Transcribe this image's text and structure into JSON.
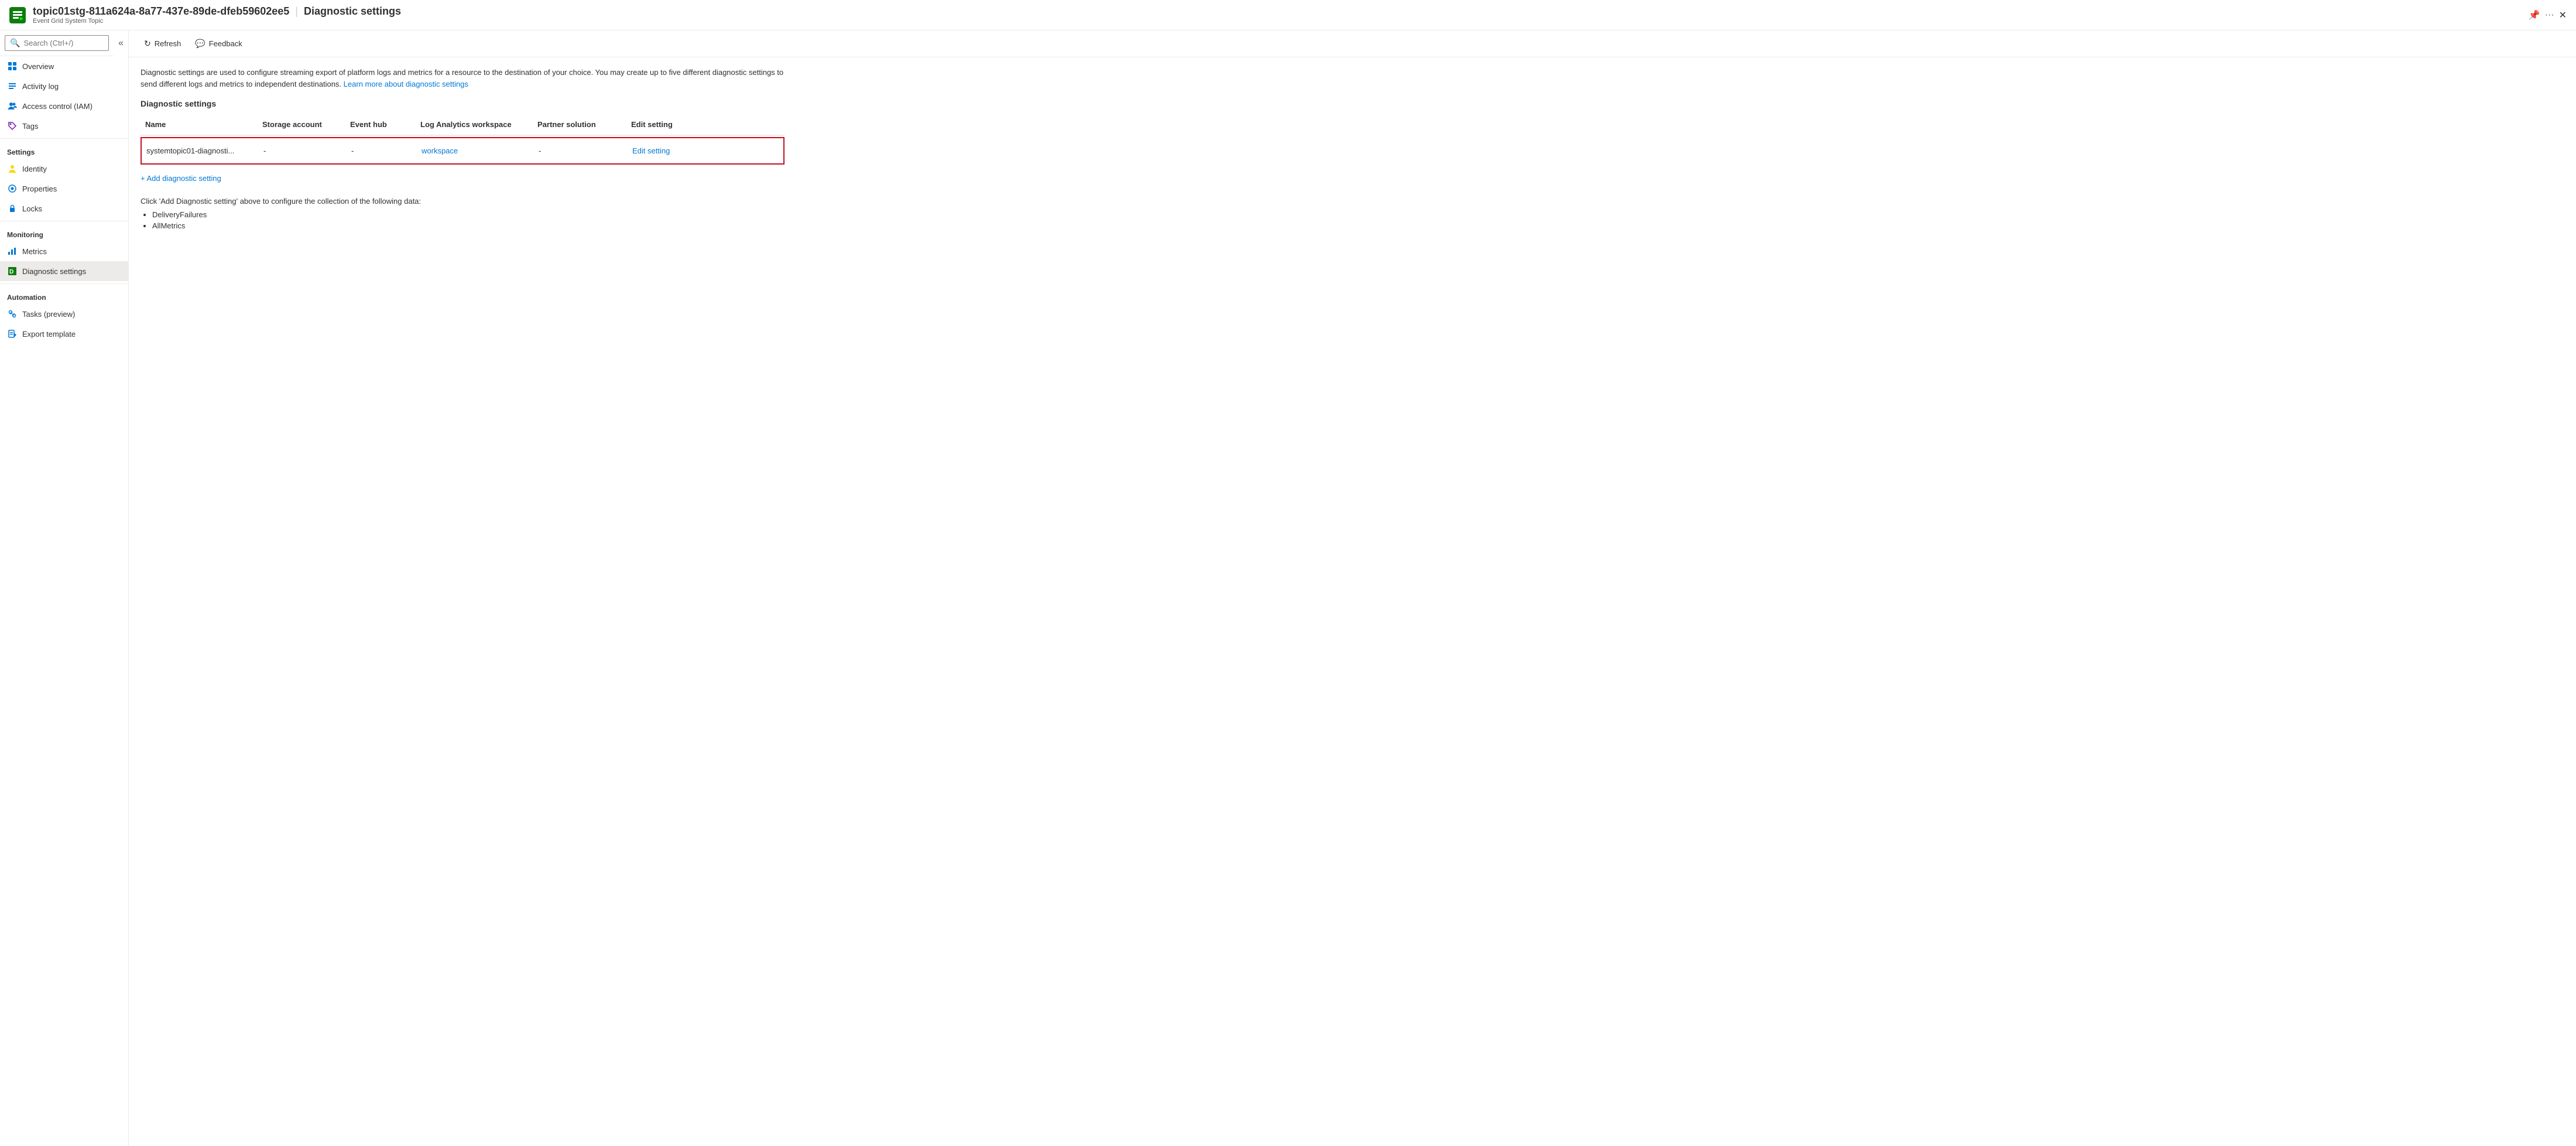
{
  "header": {
    "icon_color": "#107c10",
    "title": "topic01stg-811a624a-8a77-437e-89de-dfeb59602ee5",
    "separator": "|",
    "page_title": "Diagnostic settings",
    "subtitle": "Event Grid System Topic"
  },
  "toolbar": {
    "refresh_label": "Refresh",
    "feedback_label": "Feedback"
  },
  "description": {
    "text1": "Diagnostic settings are used to configure streaming export of platform logs and metrics for a resource to the destination of your choice. You may create up to five different diagnostic settings to send different logs and metrics to independent destinations.",
    "link_text": "Learn more about diagnostic settings"
  },
  "section_title": "Diagnostic settings",
  "table": {
    "headers": [
      "Name",
      "Storage account",
      "Event hub",
      "Log Analytics workspace",
      "Partner solution",
      "Edit setting"
    ],
    "rows": [
      {
        "name": "systemtopic01-diagnosti...",
        "storage_account": "-",
        "event_hub": "-",
        "log_analytics_workspace": "workspace",
        "partner_solution": "-",
        "edit_setting": "Edit setting"
      }
    ]
  },
  "add_setting": "+ Add diagnostic setting",
  "info": {
    "text": "Click 'Add Diagnostic setting' above to configure the collection of the following data:",
    "items": [
      "DeliveryFailures",
      "AllMetrics"
    ]
  },
  "sidebar": {
    "search_placeholder": "Search (Ctrl+/)",
    "nav_items": [
      {
        "id": "overview",
        "label": "Overview",
        "section": null
      },
      {
        "id": "activity-log",
        "label": "Activity log",
        "section": null
      },
      {
        "id": "access-control",
        "label": "Access control (IAM)",
        "section": null
      },
      {
        "id": "tags",
        "label": "Tags",
        "section": null
      },
      {
        "id": "settings",
        "label": "Settings",
        "section": "section"
      },
      {
        "id": "identity",
        "label": "Identity",
        "section": null
      },
      {
        "id": "properties",
        "label": "Properties",
        "section": null
      },
      {
        "id": "locks",
        "label": "Locks",
        "section": null
      },
      {
        "id": "monitoring",
        "label": "Monitoring",
        "section": "section"
      },
      {
        "id": "metrics",
        "label": "Metrics",
        "section": null
      },
      {
        "id": "diagnostic-settings",
        "label": "Diagnostic settings",
        "section": null,
        "active": true
      },
      {
        "id": "automation",
        "label": "Automation",
        "section": "section"
      },
      {
        "id": "tasks-preview",
        "label": "Tasks (preview)",
        "section": null
      },
      {
        "id": "export-template",
        "label": "Export template",
        "section": null
      }
    ]
  }
}
